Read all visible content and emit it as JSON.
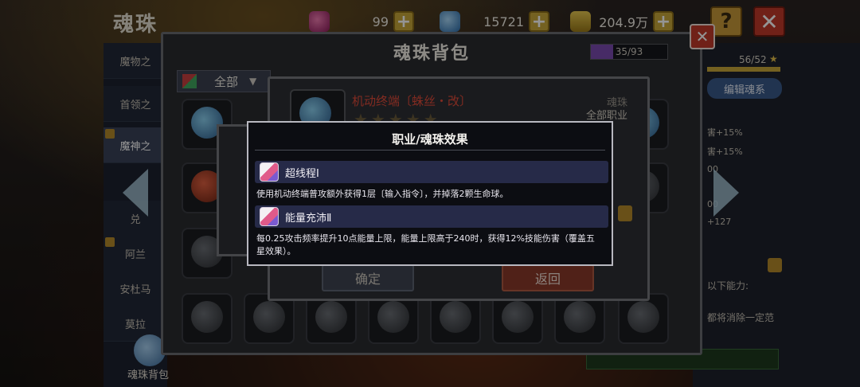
{
  "header": {
    "title": "魂珠",
    "currencies": [
      {
        "icon": "gem-icon",
        "color": "#c0307a",
        "value": "99"
      },
      {
        "icon": "diamond-icon",
        "color": "#4a9ad8",
        "value": "15721"
      },
      {
        "icon": "gold-icon",
        "color": "#c8a030",
        "value": "204.9万"
      }
    ],
    "help_label": "?",
    "close_label": "✕"
  },
  "sidebar": {
    "items": [
      {
        "label": "魔物之"
      },
      {
        "label": "首领之"
      },
      {
        "label": "魔神之"
      },
      {
        "label": "兑"
      },
      {
        "label": "阿兰"
      },
      {
        "label": "安杜马"
      },
      {
        "label": "莫拉"
      }
    ],
    "bag_label": "魂珠背包"
  },
  "right_panel": {
    "count": "56/52",
    "star": "★",
    "edit_label": "编辑魂系",
    "stats": [
      "害+15%",
      "害+15%",
      "00",
      "00",
      "+127"
    ],
    "notes": [
      "以下能力:",
      "都将消除一定范"
    ]
  },
  "bag": {
    "title": "魂珠背包",
    "capacity": "35/93",
    "filter_label": "全部",
    "filter_caret": "▼",
    "close_label": "✕"
  },
  "detail": {
    "name": "机动终端〔蛛丝・改〕",
    "stars": "★★★★★",
    "type": "魂珠",
    "job": "全部职业",
    "confirm_label": "确定",
    "back_label": "返回"
  },
  "modal": {
    "title": "职业/魂珠效果",
    "effects": [
      {
        "name": "超线程Ⅰ",
        "desc": "使用机动终端普攻额外获得1层〔输入指令〕，并掉落2颗生命球。"
      },
      {
        "name": "能量充沛Ⅱ",
        "desc": "每0.25攻击频率提升10点能量上限，能量上限高于240时，获得12%技能伤害（覆盖五星效果）。"
      }
    ]
  }
}
